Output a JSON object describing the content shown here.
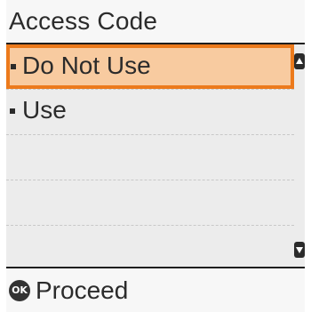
{
  "header": {
    "title": "Access Code"
  },
  "menu": {
    "items": [
      {
        "label": "Do Not Use",
        "selected": true
      },
      {
        "label": "Use",
        "selected": false
      }
    ]
  },
  "scrollbar": {
    "up_icon": "scroll-up-icon",
    "down_icon": "scroll-down-icon"
  },
  "footer": {
    "button_glyph": "OK",
    "action_label": "Proceed"
  },
  "colors": {
    "selection_fill": "#f8cba0",
    "selection_border": "#ec7a1c",
    "text": "#2b2b2b"
  }
}
